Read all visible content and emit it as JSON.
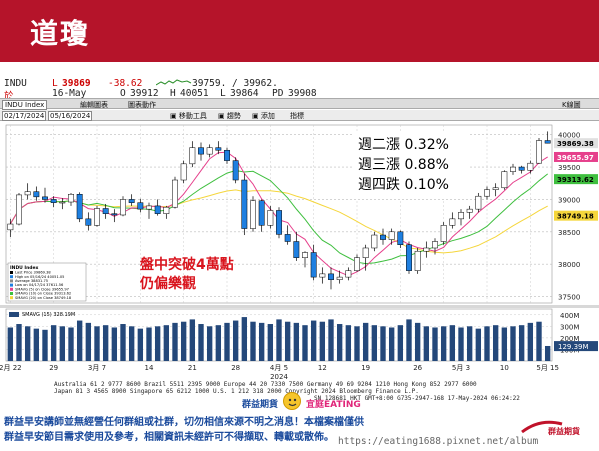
{
  "header": {
    "title": "道瓊"
  },
  "quote": {
    "symbol": "INDU",
    "last_prefix": "L",
    "last": "39869",
    "change": "-38.62",
    "bid_ask": "39759. / 39962.",
    "exchange": "於",
    "date": "16-May",
    "open_prefix": "O",
    "open": "39912",
    "high_prefix": "H",
    "high": "40051",
    "low_prefix": "L",
    "low": "39864",
    "prev_prefix": "PD",
    "prev": "39908"
  },
  "toolbar": {
    "field": "INDU Index",
    "edit_chart": "編輯圖表",
    "chart_action": "圖表動作",
    "chart_icon": "K線圖",
    "from": "02/17/2024",
    "to": "05/16/2024",
    "tools": "▣ 移動工具",
    "trend": "▣ 趨勢",
    "add": "▣ 添加",
    "indicators": "指標"
  },
  "annotations": {
    "perf_lines": [
      "週二漲 0.32%",
      "週三漲 0.88%",
      "週四跌 0.10%"
    ],
    "callout_lines": [
      "盤中突破4萬點",
      "仍偏樂觀"
    ]
  },
  "legend": {
    "title": "INDU Index",
    "items": [
      "Last Price  39869.38",
      "High on 05/16/24  40051.05",
      "Average  38831.75",
      "Low on 04/17/24  37611.56",
      "SMAVG (5) on Close  39655.97",
      "SMAVG (10) on Close  39313.62",
      "SMAVG (20) on Close  38749.18"
    ],
    "volume_label": "SMAVG (15) 328.19M"
  },
  "price_axis": {
    "ticks": [
      "40000",
      "39500",
      "39000",
      "38500",
      "38000",
      "37500"
    ],
    "badges": [
      {
        "text": "39869.38",
        "color": "#e0e0e0",
        "text_color": "#000000"
      },
      {
        "text": "39655.97",
        "color": "#e6408c",
        "text_color": "#ffffff"
      },
      {
        "text": "39313.62",
        "color": "#3fbf3f",
        "text_color": "#000000"
      },
      {
        "text": "38749.18",
        "color": "#f5d63c",
        "text_color": "#000000"
      }
    ]
  },
  "volume_axis": {
    "ticks": [
      "400M",
      "300M",
      "200M",
      "100M"
    ],
    "badge": "129.39M"
  },
  "x_axis": {
    "labels": [
      "2月 22",
      "29",
      "3月 7",
      "14",
      "21",
      "28",
      "4月 5",
      "12",
      "19",
      "26",
      "5月 3",
      "10",
      "5月 15"
    ],
    "year": "2024"
  },
  "copyright": {
    "line1": "Australia 61 2 9777 8600  Brazil 5511 2395 9000  Europe 44 20 7330 7500  Germany 49 69 9204 1210  Hong Kong 852 2977 6000",
    "line2": "Japan 81 3 4565 8900       Singapore 65 6212 1000       U.S. 1 212 318 2000        Copyright 2024 Bloomberg Finance L.P.",
    "line3": "SN 128681 HKT  GMT+8:00 G735-2947-168 17-May-2024  06:24:22"
  },
  "footer": {
    "line1": "群益早安講師並無經營任何群組或社群，切勿相信來源不明之消息！本檔案檔僅供",
    "line2": "群益早安節目需求使用及參考，相關資訊未經許可不得擷取、轉載或散佈。",
    "brand": "群益期貨",
    "eating": "宜庭EATING",
    "corner_brand": "群益期貨",
    "watermark": "https://eating1688.pixnet.net/album"
  },
  "colors": {
    "title_bg": "#b5142a",
    "up_candle": "#ffffff",
    "down_candle": "#1e7fe0",
    "ma5": "#e6408c",
    "ma10": "#3fbf3f",
    "ma20": "#f5d63c",
    "volume": "#24487a"
  },
  "chart_data": {
    "type": "candlestick",
    "title": "INDU Index",
    "ylim": [
      37400,
      40150
    ],
    "candles": [
      {
        "o": 38530,
        "h": 38700,
        "l": 38420,
        "c": 38620
      },
      {
        "o": 38620,
        "h": 39100,
        "l": 38600,
        "c": 39070
      },
      {
        "o": 39070,
        "h": 39250,
        "l": 39000,
        "c": 39120
      },
      {
        "o": 39120,
        "h": 39200,
        "l": 38980,
        "c": 39040
      },
      {
        "o": 39040,
        "h": 39180,
        "l": 38950,
        "c": 39000
      },
      {
        "o": 39000,
        "h": 39050,
        "l": 38880,
        "c": 38950
      },
      {
        "o": 38950,
        "h": 39020,
        "l": 38850,
        "c": 38960
      },
      {
        "o": 38960,
        "h": 39100,
        "l": 38900,
        "c": 39080
      },
      {
        "o": 39080,
        "h": 39110,
        "l": 38650,
        "c": 38700
      },
      {
        "o": 38700,
        "h": 38800,
        "l": 38520,
        "c": 38600
      },
      {
        "o": 38600,
        "h": 38900,
        "l": 38580,
        "c": 38860
      },
      {
        "o": 38860,
        "h": 38930,
        "l": 38700,
        "c": 38780
      },
      {
        "o": 38780,
        "h": 38850,
        "l": 38650,
        "c": 38760
      },
      {
        "o": 38760,
        "h": 39050,
        "l": 38740,
        "c": 39000
      },
      {
        "o": 39000,
        "h": 39080,
        "l": 38900,
        "c": 38950
      },
      {
        "o": 38950,
        "h": 39010,
        "l": 38800,
        "c": 38850
      },
      {
        "o": 38850,
        "h": 38950,
        "l": 38700,
        "c": 38900
      },
      {
        "o": 38900,
        "h": 39000,
        "l": 38750,
        "c": 38780
      },
      {
        "o": 38780,
        "h": 38900,
        "l": 38700,
        "c": 38880
      },
      {
        "o": 38880,
        "h": 39350,
        "l": 38860,
        "c": 39300
      },
      {
        "o": 39300,
        "h": 39600,
        "l": 39250,
        "c": 39550
      },
      {
        "o": 39550,
        "h": 39900,
        "l": 39500,
        "c": 39800
      },
      {
        "o": 39800,
        "h": 39880,
        "l": 39600,
        "c": 39700
      },
      {
        "o": 39700,
        "h": 39850,
        "l": 39650,
        "c": 39800
      },
      {
        "o": 39800,
        "h": 39900,
        "l": 39700,
        "c": 39760
      },
      {
        "o": 39760,
        "h": 39800,
        "l": 39550,
        "c": 39600
      },
      {
        "o": 39600,
        "h": 39650,
        "l": 39250,
        "c": 39300
      },
      {
        "o": 39300,
        "h": 39400,
        "l": 38450,
        "c": 38550
      },
      {
        "o": 38550,
        "h": 39050,
        "l": 38500,
        "c": 38980
      },
      {
        "o": 38980,
        "h": 39000,
        "l": 38500,
        "c": 38600
      },
      {
        "o": 38600,
        "h": 38900,
        "l": 38550,
        "c": 38830
      },
      {
        "o": 38830,
        "h": 38880,
        "l": 38400,
        "c": 38460
      },
      {
        "o": 38460,
        "h": 38600,
        "l": 38300,
        "c": 38350
      },
      {
        "o": 38350,
        "h": 38500,
        "l": 38050,
        "c": 38100
      },
      {
        "o": 38100,
        "h": 38200,
        "l": 37950,
        "c": 38180
      },
      {
        "o": 38180,
        "h": 38300,
        "l": 37750,
        "c": 37800
      },
      {
        "o": 37800,
        "h": 37950,
        "l": 37700,
        "c": 37850
      },
      {
        "o": 37850,
        "h": 37950,
        "l": 37611,
        "c": 37760
      },
      {
        "o": 37760,
        "h": 37900,
        "l": 37700,
        "c": 37800
      },
      {
        "o": 37800,
        "h": 37950,
        "l": 37750,
        "c": 37900
      },
      {
        "o": 37900,
        "h": 38150,
        "l": 37880,
        "c": 38100
      },
      {
        "o": 38100,
        "h": 38300,
        "l": 37900,
        "c": 38250
      },
      {
        "o": 38250,
        "h": 38500,
        "l": 38200,
        "c": 38450
      },
      {
        "o": 38450,
        "h": 38550,
        "l": 38300,
        "c": 38380
      },
      {
        "o": 38380,
        "h": 38550,
        "l": 38300,
        "c": 38500
      },
      {
        "o": 38500,
        "h": 38520,
        "l": 38250,
        "c": 38300
      },
      {
        "o": 38300,
        "h": 38350,
        "l": 37850,
        "c": 37900
      },
      {
        "o": 37900,
        "h": 38250,
        "l": 37850,
        "c": 38200
      },
      {
        "o": 38200,
        "h": 38350,
        "l": 38100,
        "c": 38250
      },
      {
        "o": 38250,
        "h": 38400,
        "l": 38150,
        "c": 38350
      },
      {
        "o": 38350,
        "h": 38650,
        "l": 38300,
        "c": 38600
      },
      {
        "o": 38600,
        "h": 38800,
        "l": 38550,
        "c": 38700
      },
      {
        "o": 38700,
        "h": 38850,
        "l": 38600,
        "c": 38800
      },
      {
        "o": 38800,
        "h": 38900,
        "l": 38700,
        "c": 38850
      },
      {
        "o": 38850,
        "h": 39100,
        "l": 38800,
        "c": 39050
      },
      {
        "o": 39050,
        "h": 39200,
        "l": 39000,
        "c": 39150
      },
      {
        "o": 39150,
        "h": 39250,
        "l": 39050,
        "c": 39180
      },
      {
        "o": 39180,
        "h": 39450,
        "l": 39150,
        "c": 39430
      },
      {
        "o": 39430,
        "h": 39550,
        "l": 39380,
        "c": 39500
      },
      {
        "o": 39500,
        "h": 39520,
        "l": 39400,
        "c": 39450
      },
      {
        "o": 39450,
        "h": 39600,
        "l": 39400,
        "c": 39560
      },
      {
        "o": 39560,
        "h": 39950,
        "l": 39550,
        "c": 39910
      },
      {
        "o": 39910,
        "h": 40051,
        "l": 39864,
        "c": 39869
      }
    ],
    "volume": [
      290,
      320,
      300,
      280,
      270,
      310,
      300,
      290,
      350,
      330,
      300,
      310,
      290,
      320,
      300,
      280,
      290,
      300,
      310,
      330,
      340,
      360,
      320,
      300,
      310,
      330,
      350,
      380,
      340,
      330,
      320,
      360,
      340,
      330,
      310,
      350,
      340,
      360,
      320,
      310,
      300,
      330,
      310,
      300,
      290,
      310,
      360,
      330,
      300,
      290,
      300,
      310,
      290,
      300,
      280,
      300,
      310,
      290,
      300,
      310,
      330,
      340,
      130
    ],
    "ma_series": [
      {
        "name": "SMAVG (5)",
        "last": 39655.97
      },
      {
        "name": "SMAVG (10)",
        "last": 39313.62
      },
      {
        "name": "SMAVG (20)",
        "last": 38749.18
      }
    ]
  }
}
